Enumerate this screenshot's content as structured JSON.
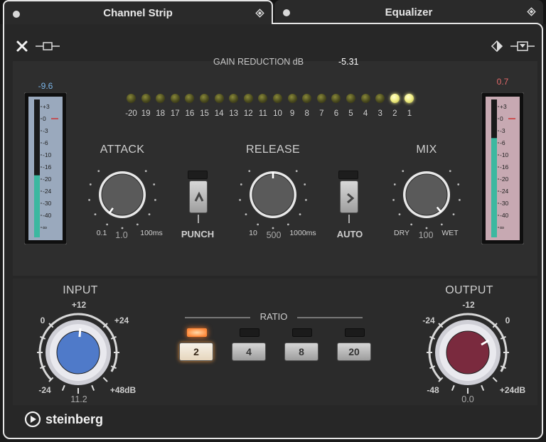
{
  "tabs": [
    {
      "label": "Channel Strip",
      "active": true
    },
    {
      "label": "Equalizer",
      "active": false
    }
  ],
  "meters": {
    "input_readout": "-9.6",
    "output_readout": "0.7",
    "input_readout_color": "#7bb5e8",
    "output_readout_color": "#e56a6a",
    "scale": [
      "+3",
      "0",
      "-3",
      "-6",
      "-10",
      "-16",
      "-20",
      "-24",
      "-30",
      "-40",
      "∞"
    ],
    "input_level": 0.45,
    "output_level": 0.72,
    "input_fill_color": "#3bb8a0",
    "output_fill_color": "#3bb8a0"
  },
  "gain_reduction": {
    "title": "GAIN REDUCTION dB",
    "value": "-5.31",
    "leds": [
      "-20",
      "19",
      "18",
      "17",
      "16",
      "15",
      "14",
      "13",
      "12",
      "11",
      "10",
      "9",
      "8",
      "7",
      "6",
      "5",
      "4",
      "3",
      "2",
      "1"
    ],
    "lit": [
      "2",
      "1"
    ]
  },
  "attack": {
    "label": "ATTACK",
    "min": "0.1",
    "value": "1.0",
    "max": "100ms"
  },
  "release": {
    "label": "RELEASE",
    "min": "10",
    "value": "500",
    "max": "1000ms"
  },
  "mix": {
    "label": "MIX",
    "min": "DRY",
    "value": "100",
    "max": "WET"
  },
  "punch": {
    "label": "PUNCH"
  },
  "auto": {
    "label": "AUTO"
  },
  "input": {
    "label": "INPUT",
    "top": "+12",
    "left": "0",
    "right": "+24",
    "bottom_left": "-24",
    "bottom_right": "+48dB",
    "value": "11.2",
    "color": "#4f7ac9"
  },
  "output": {
    "label": "OUTPUT",
    "top": "-12",
    "left": "-24",
    "right": "0",
    "bottom_left": "-48",
    "bottom_right": "+24dB",
    "value": "0.0",
    "color": "#7a2a3e"
  },
  "ratio": {
    "title": "RATIO",
    "options": [
      "2",
      "4",
      "8",
      "20"
    ],
    "selected": "2"
  },
  "brand": {
    "name": "steinberg"
  },
  "icons": {
    "close": "close-icon",
    "bypass": "bypass-icon",
    "preset": "preset-diamond-icon",
    "menu": "menu-dropdown-icon",
    "tab_pin": "pin-diamond-icon"
  }
}
